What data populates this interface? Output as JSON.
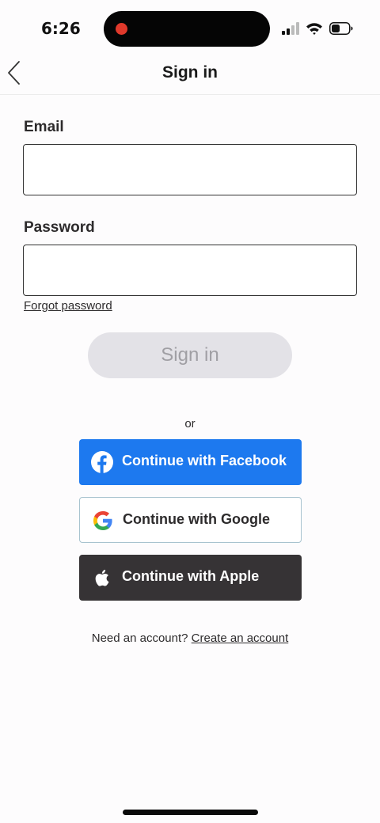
{
  "status_bar": {
    "time": "6:26",
    "icons": [
      "signal-icon",
      "wifi-icon",
      "battery-icon"
    ]
  },
  "nav": {
    "back_icon": "chevron-left-icon",
    "title": "Sign in"
  },
  "form": {
    "email_label": "Email",
    "email_value": "",
    "email_placeholder": "",
    "password_label": "Password",
    "password_value": "",
    "password_placeholder": "",
    "forgot_label": "Forgot password",
    "signin_label": "Sign in"
  },
  "divider": {
    "or_label": "or"
  },
  "social": {
    "facebook_label": "Continue with Facebook",
    "google_label": "Continue with Google",
    "apple_label": "Continue with Apple"
  },
  "footer": {
    "prompt": "Need an account?",
    "create_label": "Create an account"
  },
  "colors": {
    "facebook": "#1d79ef",
    "apple": "#363335",
    "disabled_button": "#e3e2e7",
    "recording_dot": "#e0392b"
  }
}
